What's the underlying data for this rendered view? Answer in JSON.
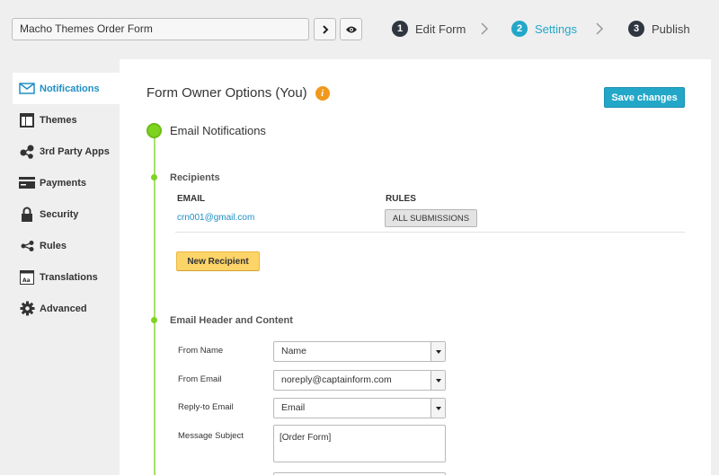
{
  "topbar": {
    "form_name": "Macho Themes Order Form",
    "steps": [
      {
        "num": "1",
        "label": "Edit Form"
      },
      {
        "num": "2",
        "label": "Settings"
      },
      {
        "num": "3",
        "label": "Publish"
      }
    ],
    "active_step": "Settings",
    "accent_color": "#23a7c9"
  },
  "sidebar": {
    "items": [
      {
        "label": "Notifications",
        "icon": "envelope-icon"
      },
      {
        "label": "Themes",
        "icon": "theme-icon"
      },
      {
        "label": "3rd Party Apps",
        "icon": "apps-icon"
      },
      {
        "label": "Payments",
        "icon": "credit-card-icon"
      },
      {
        "label": "Security",
        "icon": "lock-icon"
      },
      {
        "label": "Rules",
        "icon": "rules-icon"
      },
      {
        "label": "Translations",
        "icon": "translations-icon"
      },
      {
        "label": "Advanced",
        "icon": "gear-icon"
      }
    ],
    "active": "Notifications"
  },
  "main": {
    "title": "Form Owner Options (You)",
    "save_label": "Save changes",
    "email_notifications": "Email Notifications",
    "recipients": {
      "heading": "Recipients",
      "col_email": "EMAIL",
      "col_rules": "RULES",
      "rows": [
        {
          "email": "crn001@gmail.com",
          "rule": "ALL SUBMISSIONS"
        }
      ],
      "new_button": "New Recipient"
    },
    "header_content": {
      "heading": "Email Header and Content",
      "from_name_label": "From Name",
      "from_name_value": "Name",
      "from_email_label": "From Email",
      "from_email_value": "noreply@captainform.com",
      "reply_to_label": "Reply-to Email",
      "reply_to_value": "Email",
      "subject_label": "Message Subject",
      "subject_value": "[Order Form]"
    }
  }
}
